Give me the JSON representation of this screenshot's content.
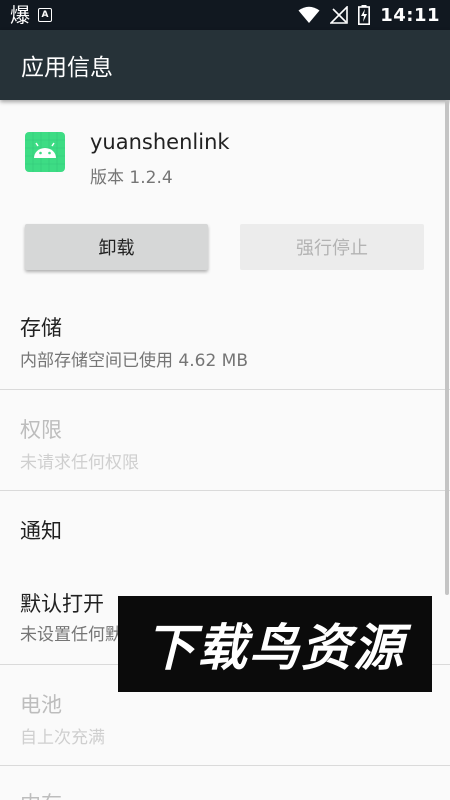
{
  "statusbar": {
    "app_glyph": "爆",
    "a_icon": "A",
    "time": "14:11",
    "icons": [
      "wifi-icon",
      "no-signal-icon",
      "battery-charging-icon"
    ]
  },
  "appbar": {
    "title": "应用信息",
    "color": "#263238"
  },
  "app": {
    "name": "yuanshenlink",
    "version": "版本 1.2.4",
    "icon": "android-icon",
    "icon_color": "#3ddc84"
  },
  "buttons": {
    "uninstall": "卸载",
    "force_stop": "强行停止"
  },
  "prefs": {
    "storage": {
      "title": "存储",
      "summary": "内部存储空间已使用 4.62 MB"
    },
    "permissions": {
      "title": "权限",
      "summary": "未请求任何权限"
    },
    "notifications": {
      "title": "通知"
    },
    "open_by_default": {
      "title": "默认打开",
      "summary": "未设置任何默认选项"
    },
    "battery": {
      "title": "电池",
      "summary": "自上次充满"
    },
    "memory": {
      "title": "内存"
    }
  },
  "watermark": {
    "text": "下载鸟资源"
  }
}
